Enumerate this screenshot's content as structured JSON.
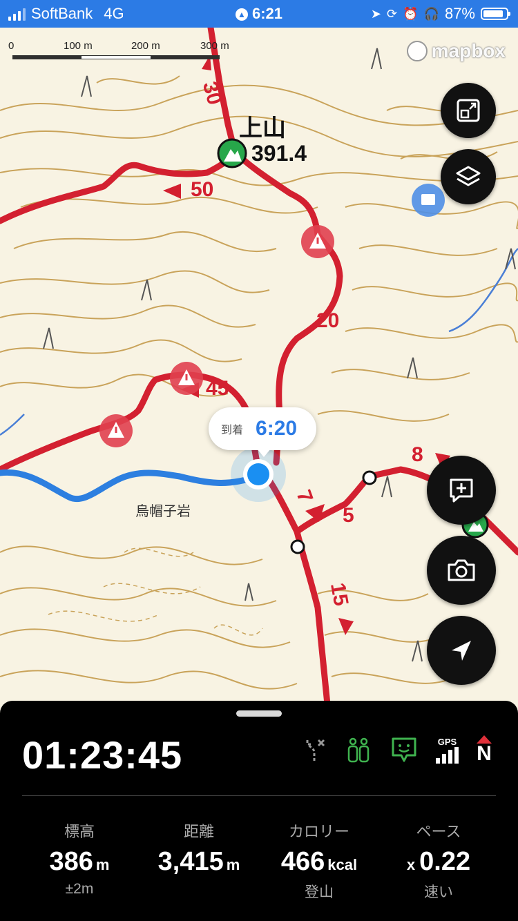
{
  "status_bar": {
    "carrier": "SoftBank",
    "network": "4G",
    "time": "6:21",
    "battery_text": "87%",
    "battery_level": 0.87
  },
  "map": {
    "scale": {
      "labels": [
        "0",
        "100 m",
        "200 m",
        "300 m"
      ]
    },
    "attribution": "mapbox",
    "peak": {
      "name": "上山",
      "altitude": "391.4"
    },
    "place_label": "烏帽子岩",
    "trail_numbers": [
      "30",
      "50",
      "20",
      "45",
      "7",
      "5",
      "15",
      "8"
    ],
    "arrival_bubble": {
      "label": "到着",
      "time": "6:20"
    },
    "colors": {
      "trail": "#d32030",
      "track": "#2d7fe0",
      "contour": "#c9a35a",
      "user": "#1a8ff2"
    }
  },
  "panel": {
    "elapsed": "01:23:45",
    "gps_label": "GPS",
    "compass_label": "N",
    "stats": [
      {
        "label": "標高",
        "value": "386",
        "unit": "m",
        "prefix": "",
        "sub": "±2m"
      },
      {
        "label": "距離",
        "value": "3,415",
        "unit": "m",
        "prefix": "",
        "sub": ""
      },
      {
        "label": "カロリー",
        "value": "466",
        "unit": "kcal",
        "prefix": "",
        "sub": "登山"
      },
      {
        "label": "ペース",
        "value": "0.22",
        "unit": "",
        "prefix": "x",
        "sub": "速い"
      }
    ]
  }
}
